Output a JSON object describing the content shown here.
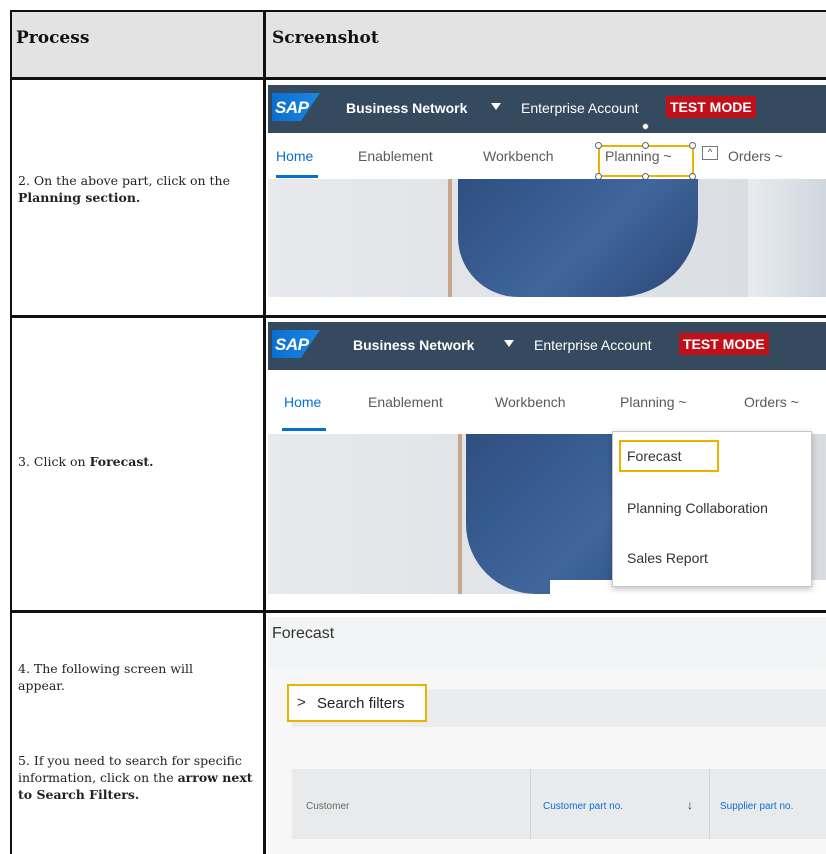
{
  "table": {
    "headers": [
      "Process",
      "Screenshot"
    ]
  },
  "rows": [
    {
      "step_pre": "2. On the above part, click on the ",
      "step_bold": "Planning section."
    },
    {
      "step_pre": "3. Click on ",
      "step_bold": "Forecast."
    },
    {
      "step_a": "4. The following screen will appear.",
      "step_pre": "5. If you need to search for specific information, click on the ",
      "step_bold": "arrow next to Search Filters."
    }
  ],
  "sap": {
    "logo": "SAP",
    "product": "Business Network",
    "account": "Enterprise Account",
    "mode": "TEST MODE",
    "nav": [
      "Home",
      "Enablement",
      "Workbench",
      "Planning ~",
      "Orders ~"
    ],
    "dropdown": [
      "Forecast",
      "Planning Collaboration",
      "Sales Report"
    ]
  },
  "forecast": {
    "title": "Forecast",
    "filter_arrow": ">",
    "filter_label": "Search filters",
    "columns": [
      "Customer",
      "Customer part no.",
      "↓",
      "Supplier part no."
    ]
  },
  "colors": {
    "sap_bar": "#354a5f",
    "sap_blue": "#0a6ed1",
    "test_mode": "#c0101a",
    "highlight": "#e8b400"
  }
}
